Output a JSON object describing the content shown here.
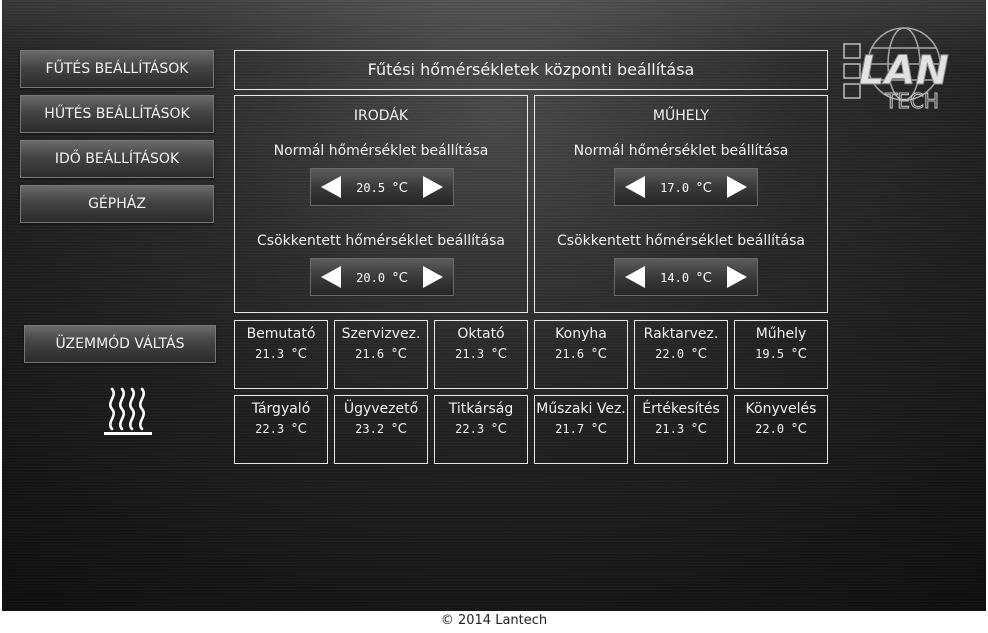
{
  "nav": {
    "heating_settings": "FŰTÉS BEÁLLÍTÁSOK",
    "cooling_settings": "HŰTÉS BEÁLLÍTÁSOK",
    "time_settings": "IDŐ BEÁLLÍTÁSOK",
    "machine_room": "GÉPHÁZ",
    "mode_switch": "ÜZEMMÓD VÁLTÁS"
  },
  "header": {
    "title": "Fűtési hőmérsékletek központi beállítása"
  },
  "logo": {
    "text_lan": "LAN",
    "text_tech": "TECH"
  },
  "unit": "°C",
  "zones": [
    {
      "title": "IRODÁK",
      "normal_label": "Normál hőmérséklet beállítása",
      "normal_value": "20.5",
      "reduced_label": "Csökkentett hőmérséklet beállítása",
      "reduced_value": "20.0"
    },
    {
      "title": "MŰHELY",
      "normal_label": "Normál hőmérséklet beállítása",
      "normal_value": "17.0",
      "reduced_label": "Csökkentett hőmérséklet beállítása",
      "reduced_value": "14.0"
    }
  ],
  "rooms": [
    {
      "name": "Bemutató",
      "temp": "21.3"
    },
    {
      "name": "Szervizvez.",
      "temp": "21.6"
    },
    {
      "name": "Oktató",
      "temp": "21.3"
    },
    {
      "name": "Konyha",
      "temp": "21.6"
    },
    {
      "name": "Raktarvez.",
      "temp": "22.0"
    },
    {
      "name": "Műhely",
      "temp": "19.5"
    },
    {
      "name": "Tárgyaló",
      "temp": "22.3"
    },
    {
      "name": "Ügyvezető",
      "temp": "23.2"
    },
    {
      "name": "Titkárság",
      "temp": "22.3"
    },
    {
      "name": "Műszaki Vez.",
      "temp": "21.7"
    },
    {
      "name": "Értékesítés",
      "temp": "21.3"
    },
    {
      "name": "Könyvelés",
      "temp": "22.0"
    }
  ],
  "footer": {
    "copyright": "© 2014 Lantech"
  }
}
